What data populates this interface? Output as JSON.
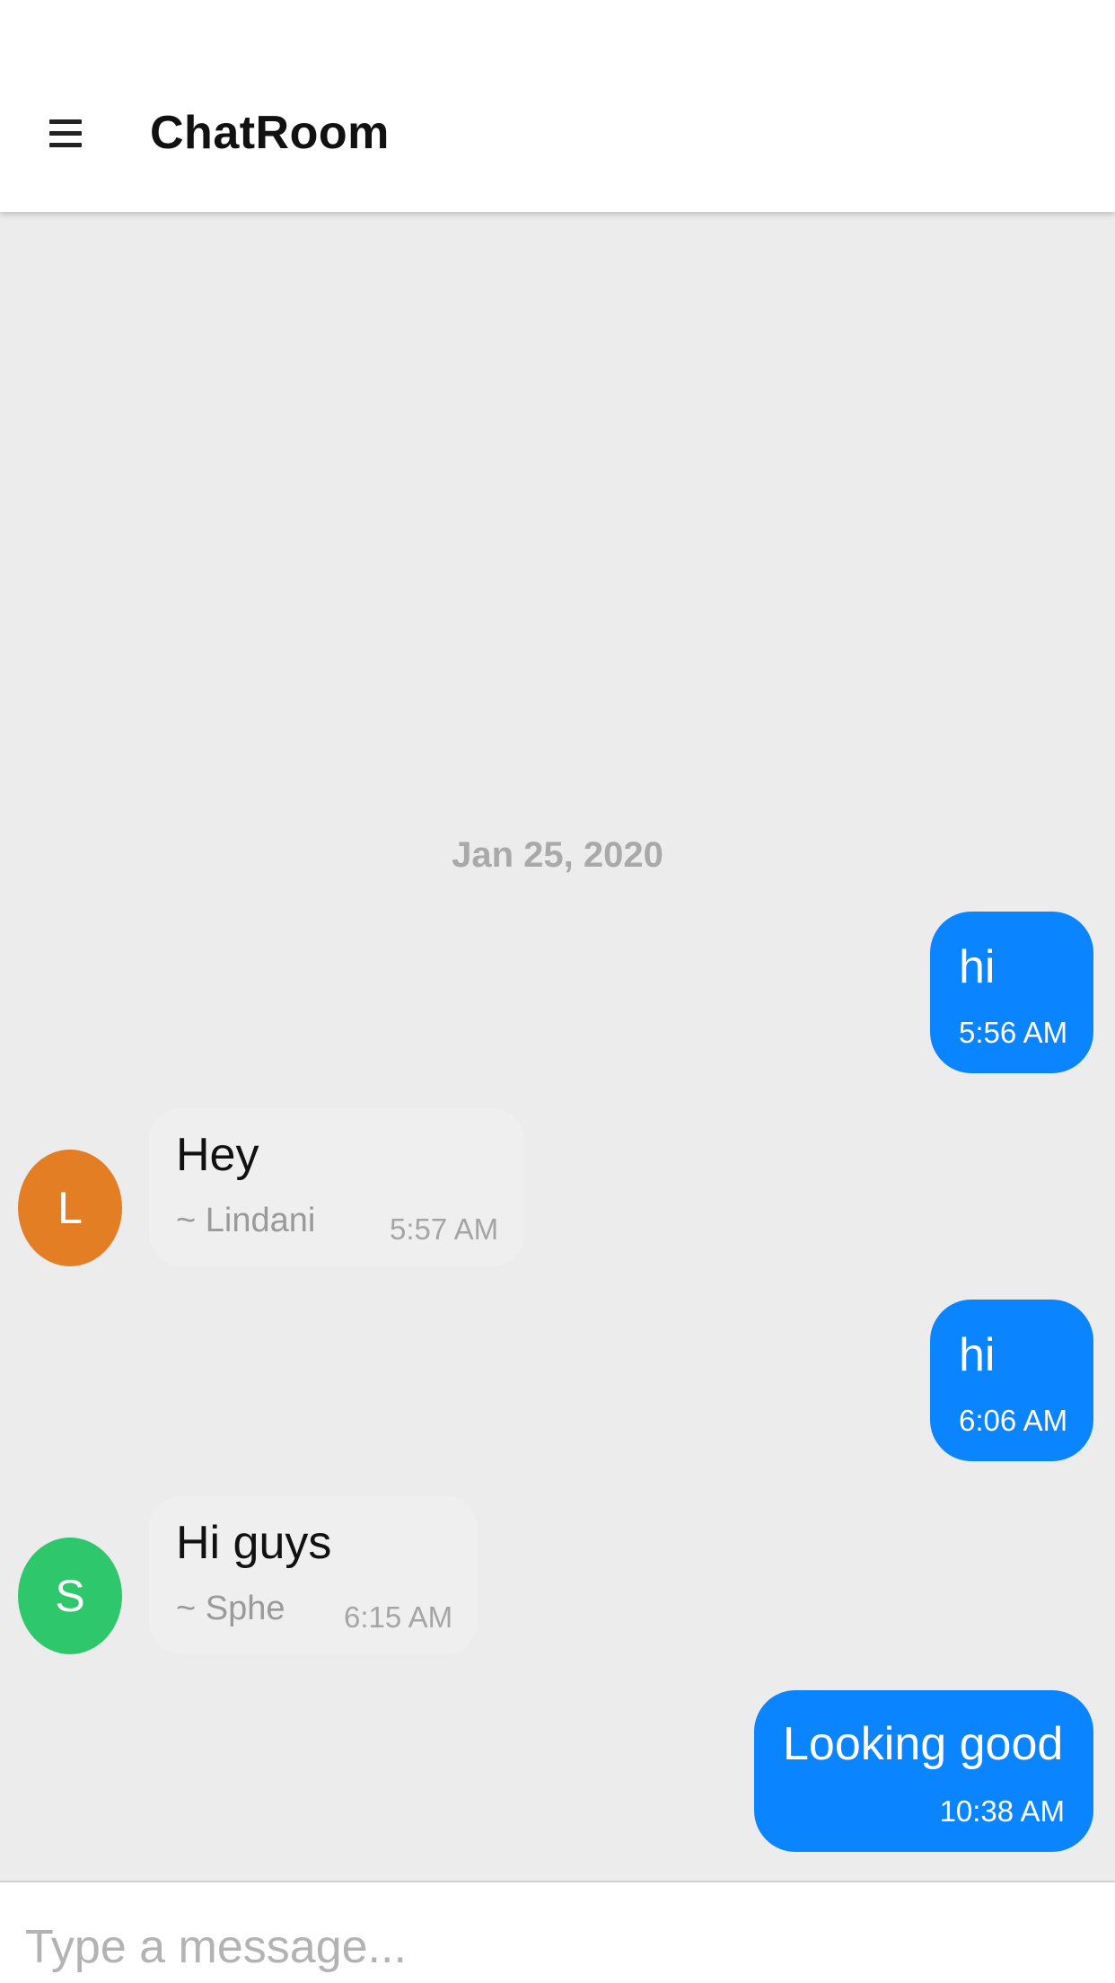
{
  "header": {
    "title": "ChatRoom",
    "menu_icon": "hamburger-menu-icon"
  },
  "chat": {
    "date_separator": "Jan 25, 2020",
    "messages": [
      {
        "direction": "outgoing",
        "text": "hi",
        "time": "5:56 AM"
      },
      {
        "direction": "incoming",
        "text": "Hey",
        "sender": "~ Lindani",
        "time": "5:57 AM",
        "avatar_letter": "L",
        "avatar_color": "#e47e24"
      },
      {
        "direction": "outgoing",
        "text": "hi",
        "time": "6:06 AM"
      },
      {
        "direction": "incoming",
        "text": "Hi guys",
        "sender": "~ Sphe",
        "time": "6:15 AM",
        "avatar_letter": "S",
        "avatar_color": "#2ec76b"
      },
      {
        "direction": "outgoing",
        "text": "Looking good",
        "time": "10:38 AM"
      }
    ]
  },
  "composer": {
    "placeholder": "Type a message...",
    "value": ""
  },
  "colors": {
    "outgoing_bubble": "#0a84ff",
    "incoming_bubble": "#efefef",
    "chat_background": "#ececec"
  }
}
